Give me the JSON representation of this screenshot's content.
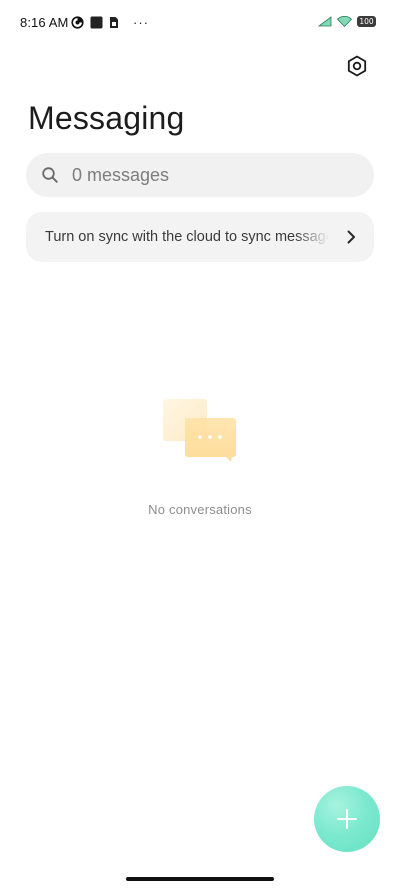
{
  "status_bar": {
    "time": "8:16 AM",
    "more": "···",
    "battery": "100",
    "icons": [
      "data-saver-icon",
      "square-notification-icon",
      "sim-icon",
      "signal-icon",
      "wifi-icon",
      "battery-icon"
    ]
  },
  "header": {
    "title": "Messaging",
    "settings_icon": "settings-icon"
  },
  "search": {
    "placeholder": "0 messages"
  },
  "sync_banner": {
    "text": "Turn on sync with the cloud to sync messages"
  },
  "empty_state": {
    "text": "No conversations",
    "icon": "chat-bubbles-icon"
  },
  "fab": {
    "icon": "plus-icon",
    "color": "#6fe6c9"
  }
}
